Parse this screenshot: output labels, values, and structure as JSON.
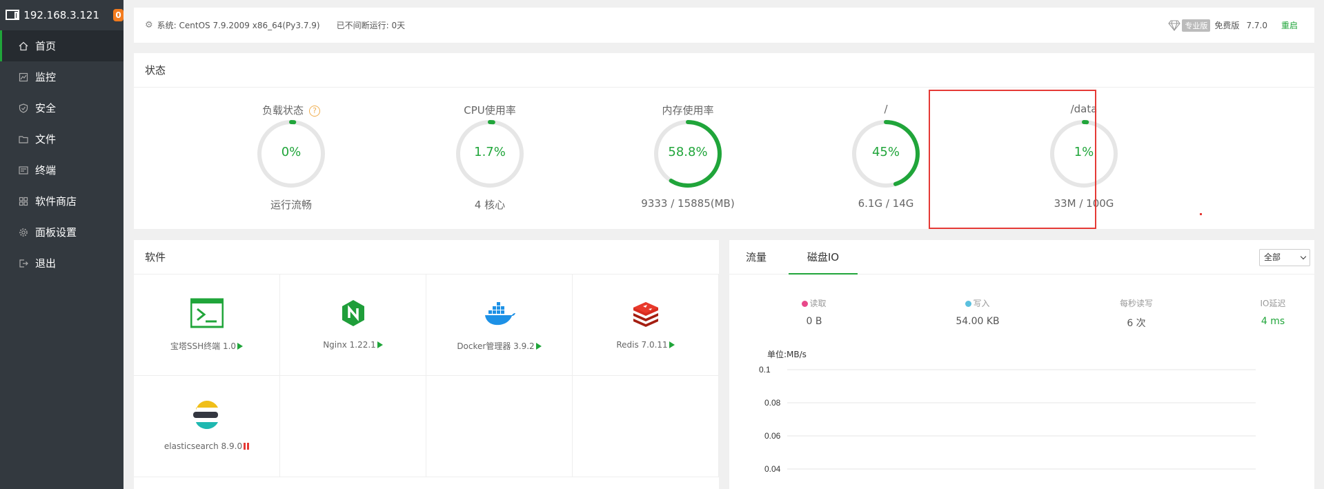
{
  "sidebar": {
    "host": "192.168.3.121",
    "badge": "0",
    "items": [
      {
        "label": "首页",
        "icon": "home-icon"
      },
      {
        "label": "监控",
        "icon": "monitor-icon"
      },
      {
        "label": "安全",
        "icon": "shield-icon"
      },
      {
        "label": "文件",
        "icon": "folder-icon"
      },
      {
        "label": "终端",
        "icon": "terminal-icon"
      },
      {
        "label": "软件商店",
        "icon": "grid-icon"
      },
      {
        "label": "面板设置",
        "icon": "gear-icon"
      },
      {
        "label": "退出",
        "icon": "logout-icon"
      }
    ]
  },
  "topbar": {
    "system": "系统:  CentOS 7.9.2009 x86_64(Py3.7.9)",
    "uptime": "已不间断运行: 0天",
    "pro_tag": "专业版",
    "free_label": "免费版",
    "version": "7.7.0",
    "restart": "重启"
  },
  "status": {
    "title": "状态",
    "gauges": [
      {
        "title": "负载状态",
        "value": "0%",
        "percent": 0,
        "sub": "运行流畅",
        "help": "?"
      },
      {
        "title": "CPU使用率",
        "value": "1.7%",
        "percent": 1.7,
        "sub": "4 核心"
      },
      {
        "title": "内存使用率",
        "value": "58.8%",
        "percent": 58.8,
        "sub": "9333 / 15885(MB)"
      },
      {
        "title": "/",
        "value": "45%",
        "percent": 45,
        "sub": "6.1G / 14G"
      },
      {
        "title": "/data",
        "value": "1%",
        "percent": 1,
        "sub": "33M / 100G"
      }
    ]
  },
  "software": {
    "title": "软件",
    "items": [
      {
        "name": "宝塔SSH终端 1.0",
        "icon": "terminal-app-icon",
        "state": "running"
      },
      {
        "name": "Nginx 1.22.1",
        "icon": "nginx-icon",
        "state": "running"
      },
      {
        "name": "Docker管理器 3.9.2",
        "icon": "docker-icon",
        "state": "running"
      },
      {
        "name": "Redis 7.0.11",
        "icon": "redis-icon",
        "state": "running"
      },
      {
        "name": "elasticsearch 8.9.0",
        "icon": "elasticsearch-icon",
        "state": "stopped"
      }
    ]
  },
  "io": {
    "tabs": [
      "流量",
      "磁盘IO"
    ],
    "active_tab": 1,
    "select_value": "全部",
    "stats": [
      {
        "label": "读取",
        "value": "0 B",
        "dot": "#e8488a"
      },
      {
        "label": "写入",
        "value": "54.00 KB",
        "dot": "#5bc0de"
      },
      {
        "label": "每秒读写",
        "value": "6 次"
      },
      {
        "label": "IO延迟",
        "value": "4 ms",
        "accent": true
      }
    ],
    "unit": "单位:MB/s",
    "y_ticks": [
      "0.1",
      "0.08",
      "0.06",
      "0.04"
    ]
  },
  "colors": {
    "accent": "#20a53a",
    "highlight": "#e53935"
  }
}
